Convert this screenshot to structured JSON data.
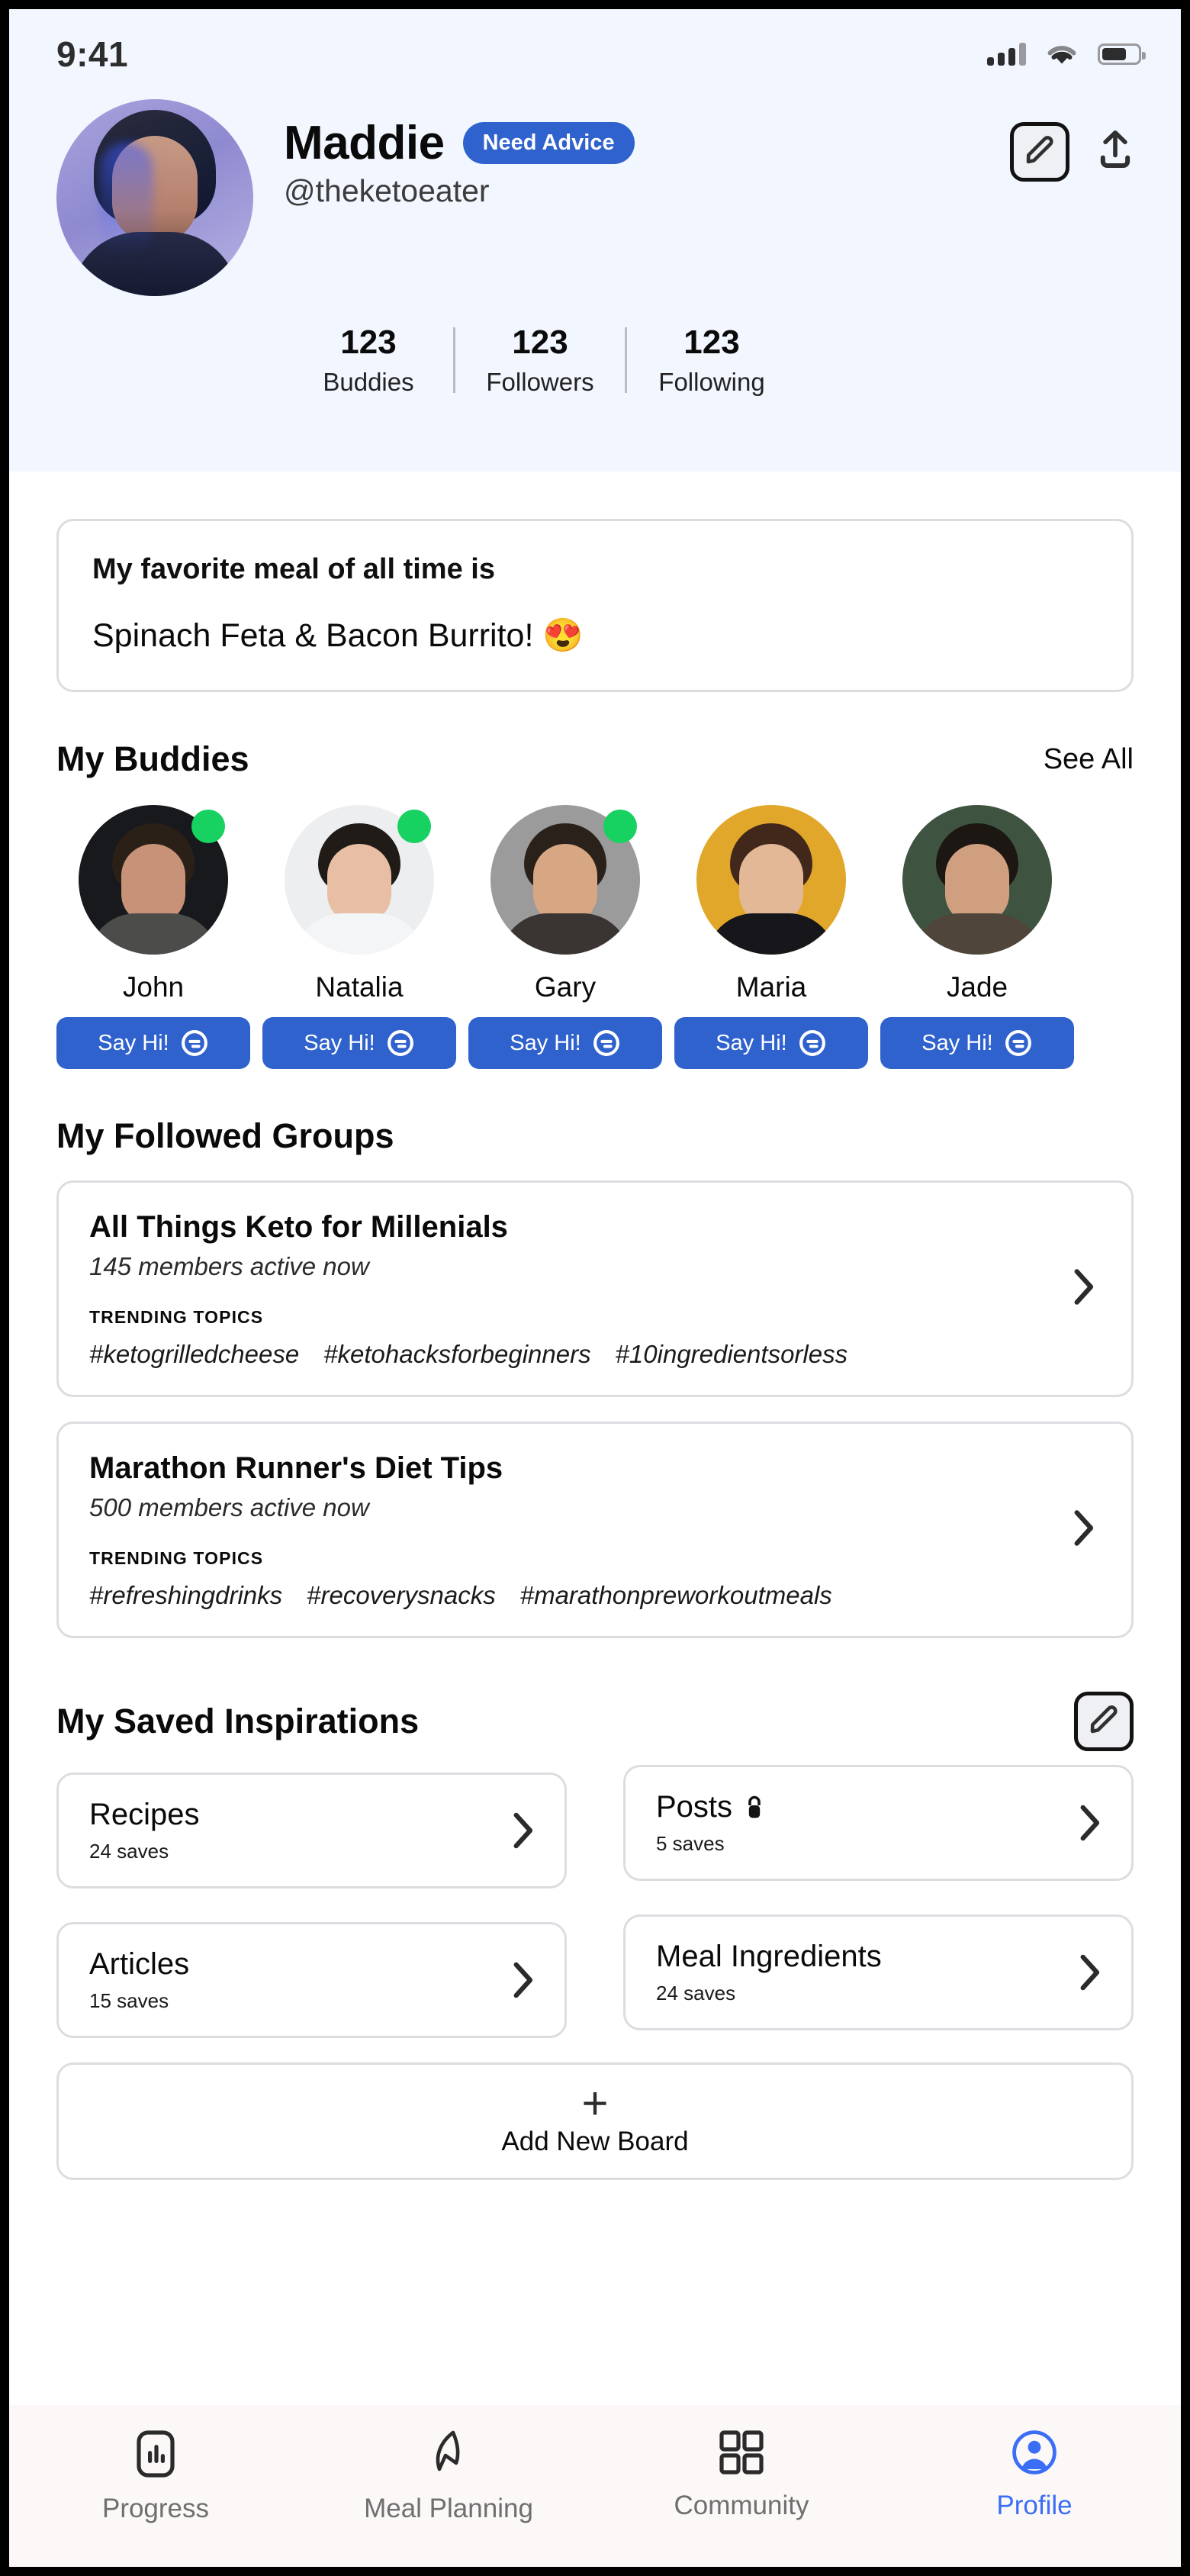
{
  "status_bar": {
    "time": "9:41",
    "signal_icon": "cellular-signal-icon",
    "wifi_icon": "wifi-icon",
    "battery_icon": "battery-icon"
  },
  "profile": {
    "avatar_alt": "profile-photo",
    "display_name": "Maddie",
    "badge_label": "Need Advice",
    "handle": "@theketoeater",
    "edit_icon": "pencil-icon",
    "share_icon": "share-upload-icon",
    "stats": [
      {
        "value": "123",
        "label": "Buddies"
      },
      {
        "value": "123",
        "label": "Followers"
      },
      {
        "value": "123",
        "label": "Following"
      }
    ]
  },
  "bio": {
    "prompt": "My favorite meal of all time is",
    "answer": "Spinach Feta & Bacon Burrito! 😍"
  },
  "buddies_section": {
    "title": "My Buddies",
    "see_all": "See All",
    "say_hi_label": "Say Hi!",
    "chat_icon": "chat-bubble-icon",
    "items": [
      {
        "name": "John",
        "online": true,
        "bg": "#17191c",
        "skin": "#c79277",
        "hair": "#2a2018",
        "shirt": "#4c4c4a"
      },
      {
        "name": "Natalia",
        "online": true,
        "bg": "#eceeef",
        "skin": "#e8bfa4",
        "hair": "#211b18",
        "shirt": "#f4f5f6"
      },
      {
        "name": "Gary",
        "online": true,
        "bg": "#9b9b9b",
        "skin": "#d7a683",
        "hair": "#2b211b",
        "shirt": "#3a3532"
      },
      {
        "name": "Maria",
        "online": false,
        "bg": "#e0a72b",
        "skin": "#e3b896",
        "hair": "#42281a",
        "shirt": "#17161a"
      },
      {
        "name": "Jade",
        "online": false,
        "bg": "#3f5440",
        "skin": "#cf9f80",
        "hair": "#1d1713",
        "shirt": "#50453b"
      }
    ]
  },
  "groups_section": {
    "title": "My Followed Groups",
    "trending_label": "TRENDING TOPICS",
    "chevron_icon": "chevron-right-icon",
    "items": [
      {
        "name": "All Things Keto for Millenials",
        "members": "145 members active now",
        "tags": [
          "#ketogrilledcheese",
          "#ketohacksforbeginners",
          "#10ingredientsorless"
        ]
      },
      {
        "name": "Marathon Runner's Diet Tips",
        "members": "500 members active now",
        "tags": [
          "#refreshingdrinks",
          "#recoverysnacks",
          "#marathonpreworkoutmeals"
        ]
      }
    ]
  },
  "inspirations_section": {
    "title": "My Saved Inspirations",
    "edit_icon": "pencil-icon",
    "chevron_icon": "chevron-right-icon",
    "boards": [
      {
        "name": "Recipes",
        "saves": "24 saves",
        "locked": false
      },
      {
        "name": "Posts",
        "saves": "5 saves",
        "locked": true,
        "lock_icon": "lock-icon"
      },
      {
        "name": "Articles",
        "saves": "15 saves",
        "locked": false
      },
      {
        "name": "Meal Ingredients",
        "saves": "24 saves",
        "locked": false
      }
    ],
    "add_board": {
      "label": "Add New Board",
      "icon": "plus-icon"
    }
  },
  "bottom_nav": {
    "active": "Profile",
    "items": [
      {
        "label": "Progress",
        "icon": "progress-chart-icon"
      },
      {
        "label": "Meal Planning",
        "icon": "leaf-icon"
      },
      {
        "label": "Community",
        "icon": "grid-squares-icon"
      },
      {
        "label": "Profile",
        "icon": "person-circle-icon"
      }
    ]
  },
  "colors": {
    "accent_blue": "#2f62cd",
    "nav_active": "#3b6ef6",
    "online_green": "#17d161",
    "header_bg": "#f2f6fe",
    "nav_bg": "#fbf8f7"
  }
}
